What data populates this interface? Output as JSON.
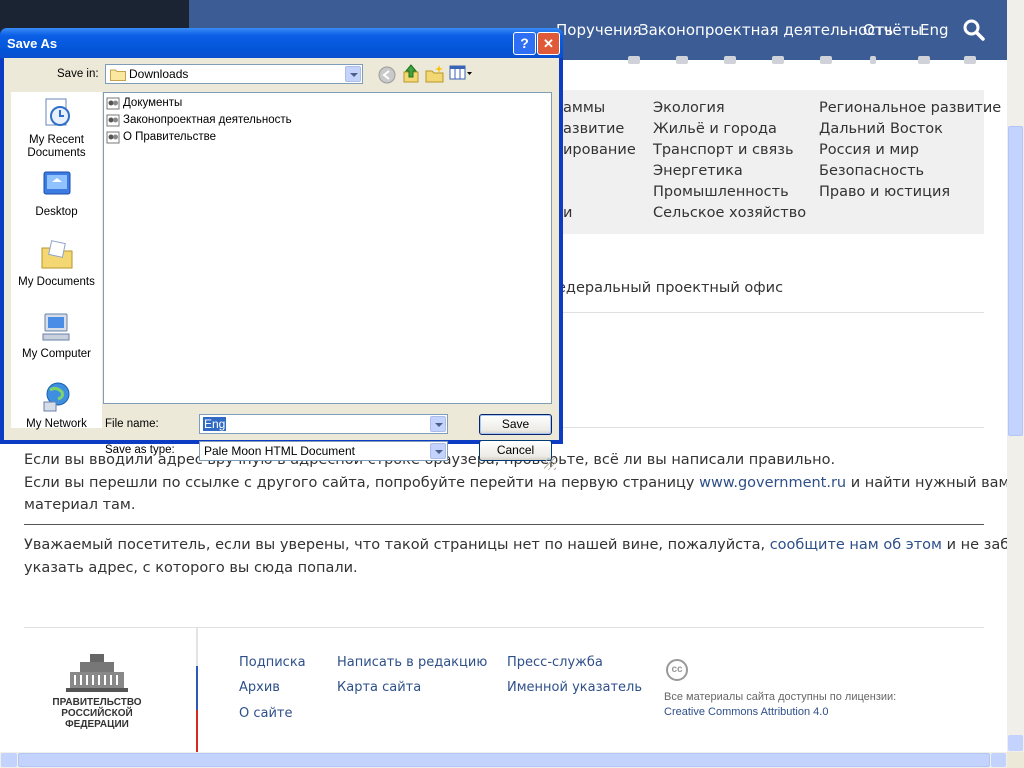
{
  "site": {
    "nav": [
      "Поручения",
      "Законопроектная деятельность",
      "Отчёты",
      "Eng"
    ],
    "topics_partial": [
      "аммы",
      "азвитие",
      "ирование",
      "и"
    ],
    "topics_col1": [
      "Экология",
      "Жильё и города",
      "Транспорт и связь",
      "Энергетика",
      "Промышленность",
      "Сельское хозяйство"
    ],
    "topics_col2": [
      "Региональное развитие",
      "Дальний Восток",
      "Россия и мир",
      "Безопасность",
      "Право и юстиция"
    ],
    "project_office": "едеральный проектный офис",
    "error_text": {
      "line1": "Если вы вводили адрес вручную в адресной строке браузера, проверьте, всё ли вы написали правильно.",
      "line2_pre": "Если вы перешли по ссылке с другого сайта, попробуйте перейти на первую страницу ",
      "line2_link": "www.government.ru",
      "line2_post": " и найти нужный вам",
      "line3": "материал там.",
      "line4_pre": "Уважаемый посетитель, если вы уверены, что такой страницы нет по нашей вине, пожалуйста, ",
      "line4_link": "сообщите нам об этом",
      "line4_post": " и не забудьте",
      "line5": "указать адрес, с которого вы сюда попали."
    },
    "footer": {
      "logo_lines": [
        "ПРАВИТЕЛЬСТВО",
        "РОССИЙСКОЙ",
        "ФЕДЕРАЦИИ"
      ],
      "col1": [
        "Подписка",
        "Архив",
        "О сайте"
      ],
      "col2": [
        "Написать в редакцию",
        "Карта сайта"
      ],
      "col3": [
        "Пресс-служба",
        "Именной указатель"
      ],
      "cc_badge": "cc",
      "license_text": "Все материалы сайта доступны по лицензии:",
      "license_link": "Creative Commons Attribution 4.0"
    }
  },
  "dialog": {
    "title": "Save As",
    "help_glyph": "?",
    "close_glyph": "✕",
    "save_in_label": "Save in:",
    "save_in_value": "Downloads",
    "places": [
      "My Recent Documents",
      "Desktop",
      "My Documents",
      "My Computer",
      "My Network"
    ],
    "files": [
      "Документы",
      "Законопроектная деятельность",
      "О Правительстве"
    ],
    "file_name_label": "File name:",
    "file_name_value": "Eng",
    "save_type_label": "Save as type:",
    "save_type_value": "Pale Moon HTML Document",
    "save_button": "Save",
    "cancel_button": "Cancel"
  },
  "colors": {
    "nav_bg": "#3c5c96",
    "title_bar": "#0456d8",
    "dialog_face": "#ece9d8",
    "link": "#2e4f8a"
  }
}
